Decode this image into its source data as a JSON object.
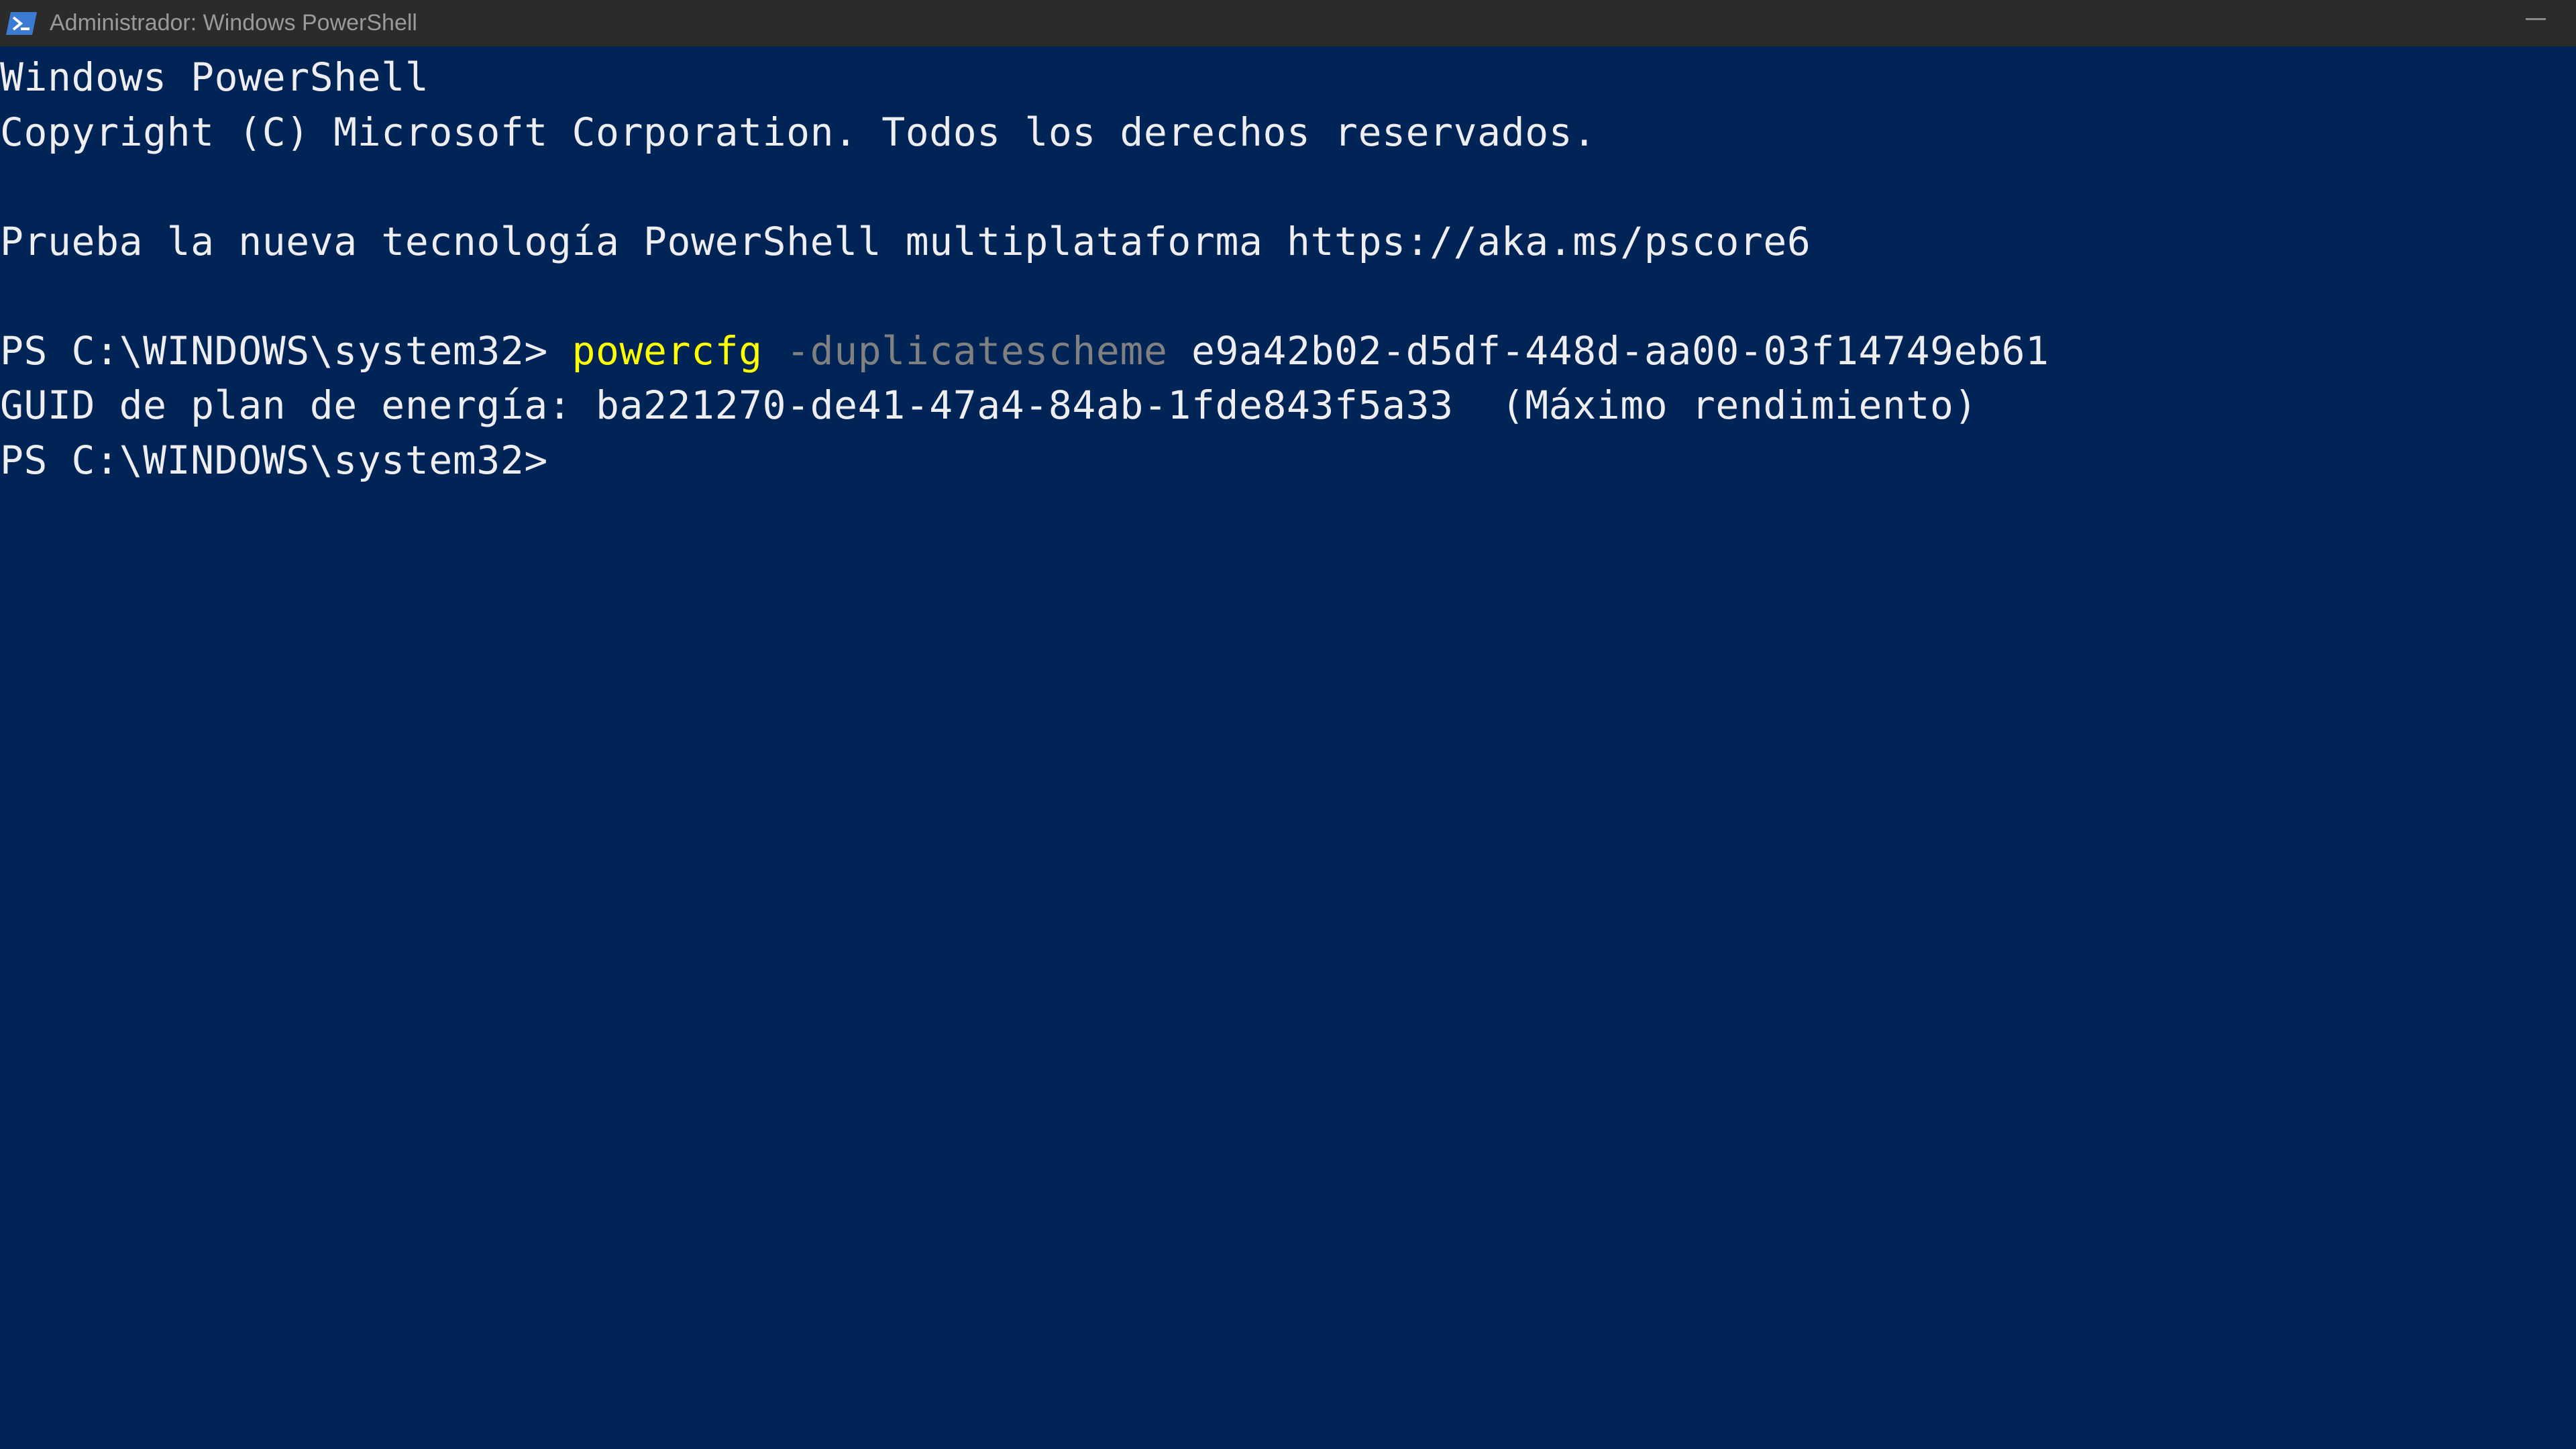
{
  "window": {
    "title": "Administrador: Windows PowerShell",
    "icon": "powershell-icon",
    "colors": {
      "titlebar_bg": "#2b2b2b",
      "console_bg": "#012456",
      "text": "#eeedf0",
      "command": "#ffff00",
      "parameter": "#808080"
    }
  },
  "console": {
    "banner_title": "Windows PowerShell",
    "copyright": "Copyright (C) Microsoft Corporation. Todos los derechos reservados.",
    "promo": "Prueba la nueva tecnología PowerShell multiplataforma https://aka.ms/pscore6",
    "prompt1": "PS C:\\WINDOWS\\system32> ",
    "command1": {
      "cmd": "powercfg",
      "param": "-duplicatescheme",
      "arg": "e9a42b02-d5df-448d-aa00-03f14749eb61"
    },
    "output1": "GUID de plan de energía: ba221270-de41-47a4-84ab-1fde843f5a33  (Máximo rendimiento)",
    "prompt2": "PS C:\\WINDOWS\\system32> "
  }
}
